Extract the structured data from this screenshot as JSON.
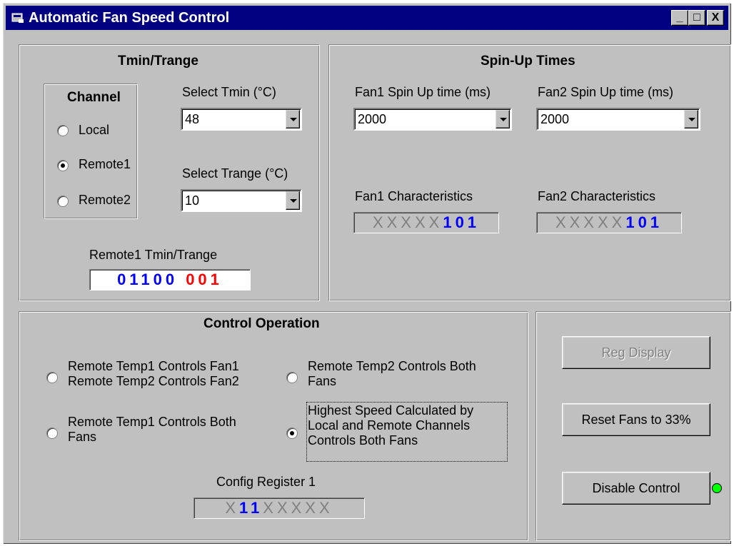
{
  "window": {
    "title": "Automatic Fan Speed Control",
    "buttons": [
      "_",
      "□",
      "X"
    ]
  },
  "tmin_panel": {
    "title": "Tmin/Trange",
    "channel": {
      "title": "Channel",
      "options": [
        "Local",
        "Remote1",
        "Remote2"
      ],
      "selected": "Remote1"
    },
    "tmin": {
      "label": "Select Tmin (°C)",
      "value": "48"
    },
    "trange": {
      "label": "Select Trange (°C)",
      "value": "10"
    },
    "register": {
      "label": "Remote1 Tmin/Trange",
      "blue": "01100",
      "red": "001"
    }
  },
  "spinup_panel": {
    "title": "Spin-Up Times",
    "fan1_label": "Fan1 Spin Up time (ms)",
    "fan1_value": "2000",
    "fan2_label": "Fan2 Spin Up time (ms)",
    "fan2_value": "2000",
    "fan1_char_label": "Fan1 Characteristics",
    "fan1_char_x": "XXXXX",
    "fan1_char_bits": "101",
    "fan2_char_label": "Fan2 Characteristics",
    "fan2_char_x": "XXXXX",
    "fan2_char_bits": "101"
  },
  "control_panel": {
    "title": "Control Operation",
    "options": [
      {
        "line1": "Remote Temp1 Controls Fan1",
        "line2": "Remote Temp2 Controls Fan2",
        "line3": ""
      },
      {
        "line1": "Remote Temp2 Controls Both",
        "line2": "Fans",
        "line3": ""
      },
      {
        "line1": "Remote Temp1 Controls Both",
        "line2": "Fans",
        "line3": ""
      },
      {
        "line1": "Highest Speed Calculated by",
        "line2": "Local and Remote Channels",
        "line3": "Controls Both Fans"
      }
    ],
    "selected_index": 3,
    "config": {
      "label": "Config Register 1",
      "x1": "X",
      "bits": "11",
      "x2": "XXXXX"
    }
  },
  "actions": {
    "reg_display": "Reg Display",
    "reset_fans": "Reset Fans to 33%",
    "disable_control": "Disable Control",
    "status_color": "#00ff00"
  },
  "colors": {
    "titlebar": "#000080",
    "face": "#c0c0c0",
    "bit_blue": "#0000ff",
    "bit_red": "#ff0000"
  }
}
